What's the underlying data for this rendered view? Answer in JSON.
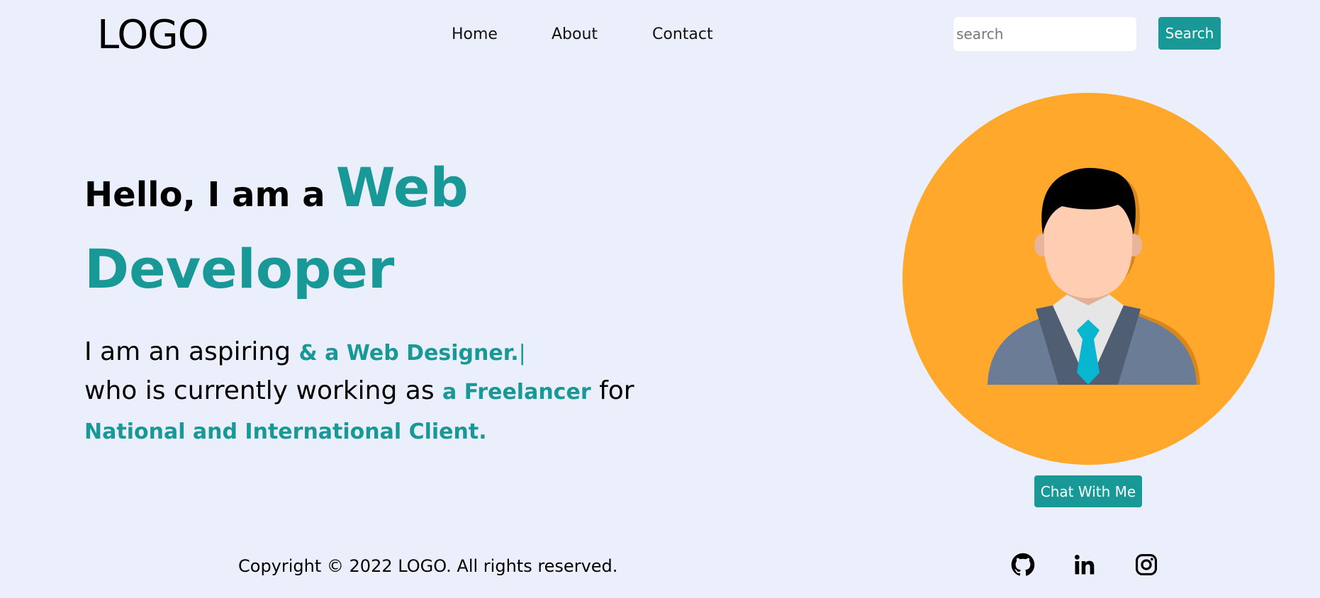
{
  "header": {
    "logo": "LOGO",
    "nav": [
      {
        "label": "Home"
      },
      {
        "label": "About"
      },
      {
        "label": "Contact"
      }
    ],
    "search": {
      "placeholder": "search",
      "button_label": "Search"
    }
  },
  "hero": {
    "greeting": "Hello, I am a",
    "title_word1": "Web",
    "title_word2": "Developer",
    "line1_text": "I am an aspiring",
    "line1_highlight": "& a Web Designer.",
    "line1_cursor": "|",
    "line2_text": "who is currently working as",
    "line2_highlight": "a Freelancer",
    "line2_tail": "for",
    "line3_highlight": "National and International Client.",
    "chat_button": "Chat With Me"
  },
  "footer": {
    "copyright": "Copyright © 2022 LOGO. All rights reserved.",
    "social": [
      {
        "icon": "github-icon"
      },
      {
        "icon": "linkedin-icon"
      },
      {
        "icon": "instagram-icon"
      }
    ]
  },
  "colors": {
    "background": "#ebeffb",
    "accent": "#189896",
    "avatar_circle": "#ffa82b"
  }
}
